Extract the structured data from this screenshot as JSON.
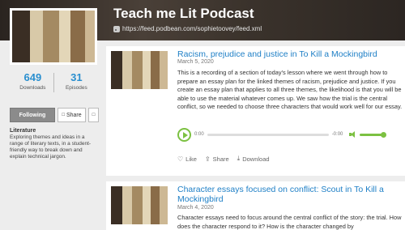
{
  "podcast": {
    "title": "Teach me Lit Podcast",
    "feed_url": "https://feed.podbean.com/sophietoovey/feed.xml"
  },
  "sidebar": {
    "downloads_count": "649",
    "downloads_label": "Downloads",
    "episodes_count": "31",
    "episodes_label": "Episodes",
    "following_label": "Following",
    "share_label": "Share",
    "about_title": "Literature",
    "about_text": "Exploring themes and ideas in a range of literary texts, in a student-friendly way to break down and explain technical jargon."
  },
  "episodes": [
    {
      "title": "Racism, prejudice and justice in To Kill a Mockingbird",
      "date": "March 5, 2020",
      "description": "This is a recording of a section of today's lesson where we went through how to prepare an essay plan for the linked themes of racism, prejudice and justice. If you create an essay plan that applies to all three themes, the likelihood is that you will be able to use the material whatever comes up. We saw how the trial is the central conflict, so we needed to choose three characters that would work well for our essay.",
      "time_start": "0:00",
      "time_end": "-0:00",
      "like_label": "Like",
      "share_label": "Share",
      "download_label": "Download"
    },
    {
      "title": "Character essays focused on conflict: Scout in To Kill a Mockingbird",
      "date": "March 4, 2020",
      "description": "Character essays need to focus around the central conflict of the story: the trial. How does the character respond to it? How is the character changed by"
    }
  ],
  "colors": {
    "accent_blue": "#1e7fc6",
    "player_green": "#7cc142"
  }
}
